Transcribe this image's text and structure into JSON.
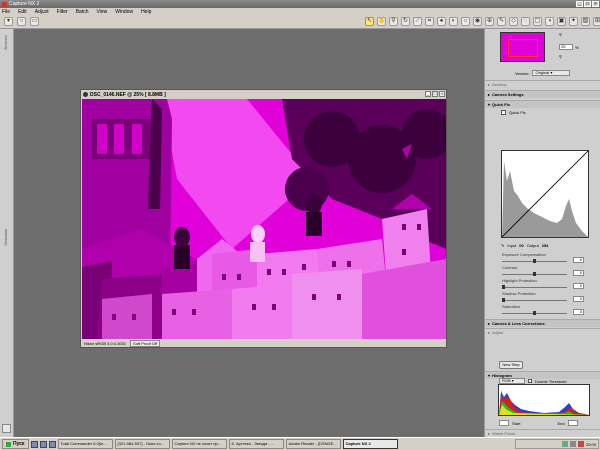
{
  "app": {
    "title": "Capture NX 2"
  },
  "menu": {
    "items": [
      "File",
      "Edit",
      "Adjust",
      "Filter",
      "Batch",
      "View",
      "Window",
      "Help"
    ]
  },
  "left_strip": {
    "tab_top": "Browser",
    "tab_mid": "Metadata"
  },
  "image_window": {
    "title": "DSC_0146.NEF @ 25% [ 8.8MB ]",
    "status_profile": "Nikon sRGB 4.0.0.3001",
    "soft_proof_label": "Soft Proof Off"
  },
  "nav": {
    "zoom_value": "25",
    "zoom_unit": "%"
  },
  "panel": {
    "version_label": "Version:",
    "version_value": "Original",
    "develop_label": "Develop",
    "camera_settings_label": "Camera Settings",
    "quick_fix_label": "Quick Fix",
    "quick_fix_sub": "Quick Fix",
    "input_label": "Input",
    "input_value": "00",
    "output_label": "Output",
    "output_value": "254",
    "sliders": [
      {
        "label": "Exposure Compensation",
        "value": "0"
      },
      {
        "label": "Contrast",
        "value": "0"
      },
      {
        "label": "Highlight Protection",
        "value": "0"
      },
      {
        "label": "Shadow Protection",
        "value": "0"
      },
      {
        "label": "Saturation",
        "value": "0"
      }
    ],
    "camera_lens_label": "Camera & Lens Corrections",
    "adjust_label": "Adjust",
    "new_step_label": "New Step",
    "histogram_label": "Histogram",
    "histogram_channel": "RGB",
    "double_threshold_label": "Double Threshold",
    "start_label": "Start",
    "end_label": "End",
    "watch_points_label": "Watch Points"
  },
  "taskbar": {
    "start_label": "Пуск",
    "tasks": [
      "Total Commander 6.0(ln...",
      "[321-984-507] - Окно со...",
      "Capture NX не хочет пр...",
      "6. Арттека - Звезда - ...",
      "Adobe Reader - [DSNGE...",
      "Capture NX 2"
    ],
    "clock": "20:09"
  },
  "colors": {
    "photo_tint": "#e000d8",
    "accent": "#ff3030"
  }
}
